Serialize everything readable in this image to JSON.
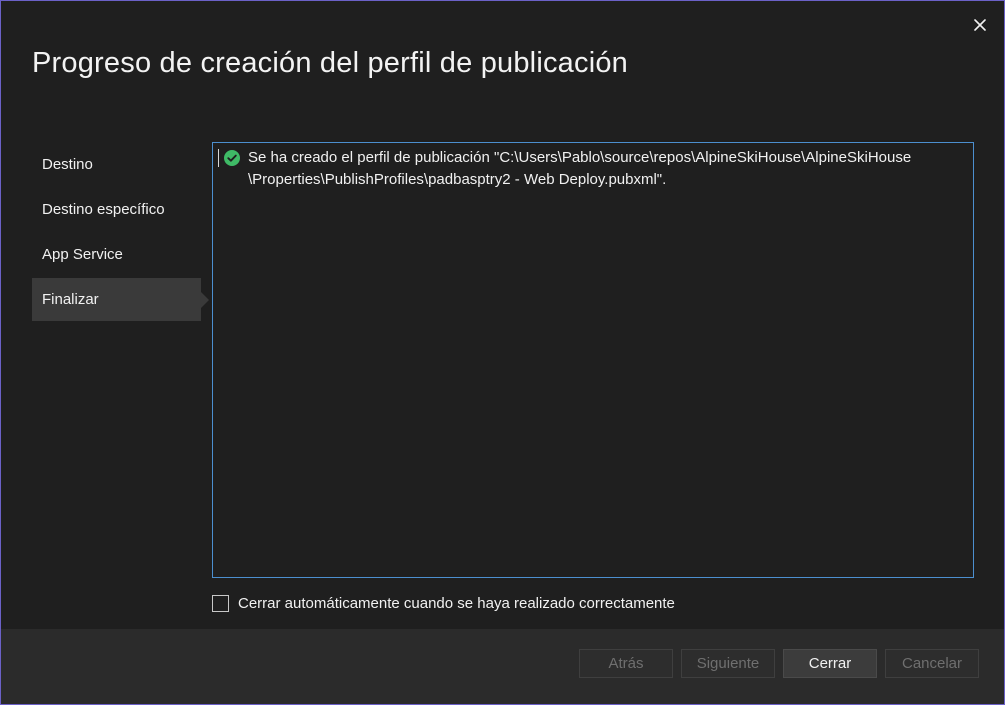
{
  "window": {
    "title": "Progreso de creación del perfil de publicación",
    "close_icon": "close-icon"
  },
  "nav": {
    "items": [
      {
        "label": "Destino",
        "active": false
      },
      {
        "label": "Destino específico",
        "active": false
      },
      {
        "label": "App Service",
        "active": false
      },
      {
        "label": "Finalizar",
        "active": true
      }
    ]
  },
  "log": {
    "status_icon": "check-circle-icon",
    "status_color": "#3fba66",
    "message": "Se ha creado el perfil de publicación \"C:\\Users\\Pablo\\source\\repos\\AlpineSkiHouse\\AlpineSkiHouse\n\\Properties\\PublishProfiles\\padbasptry2 - Web Deploy.pubxml\"."
  },
  "options": {
    "auto_close_label": "Cerrar automáticamente cuando se haya realizado correctamente",
    "auto_close_checked": false
  },
  "buttons": {
    "back": "Atrás",
    "next": "Siguiente",
    "close": "Cerrar",
    "cancel": "Cancelar"
  },
  "colors": {
    "background": "#1f1f1f",
    "panel_border": "#4c8fcf",
    "active_nav": "#3a3a3a",
    "window_border": "#6b61c7"
  }
}
